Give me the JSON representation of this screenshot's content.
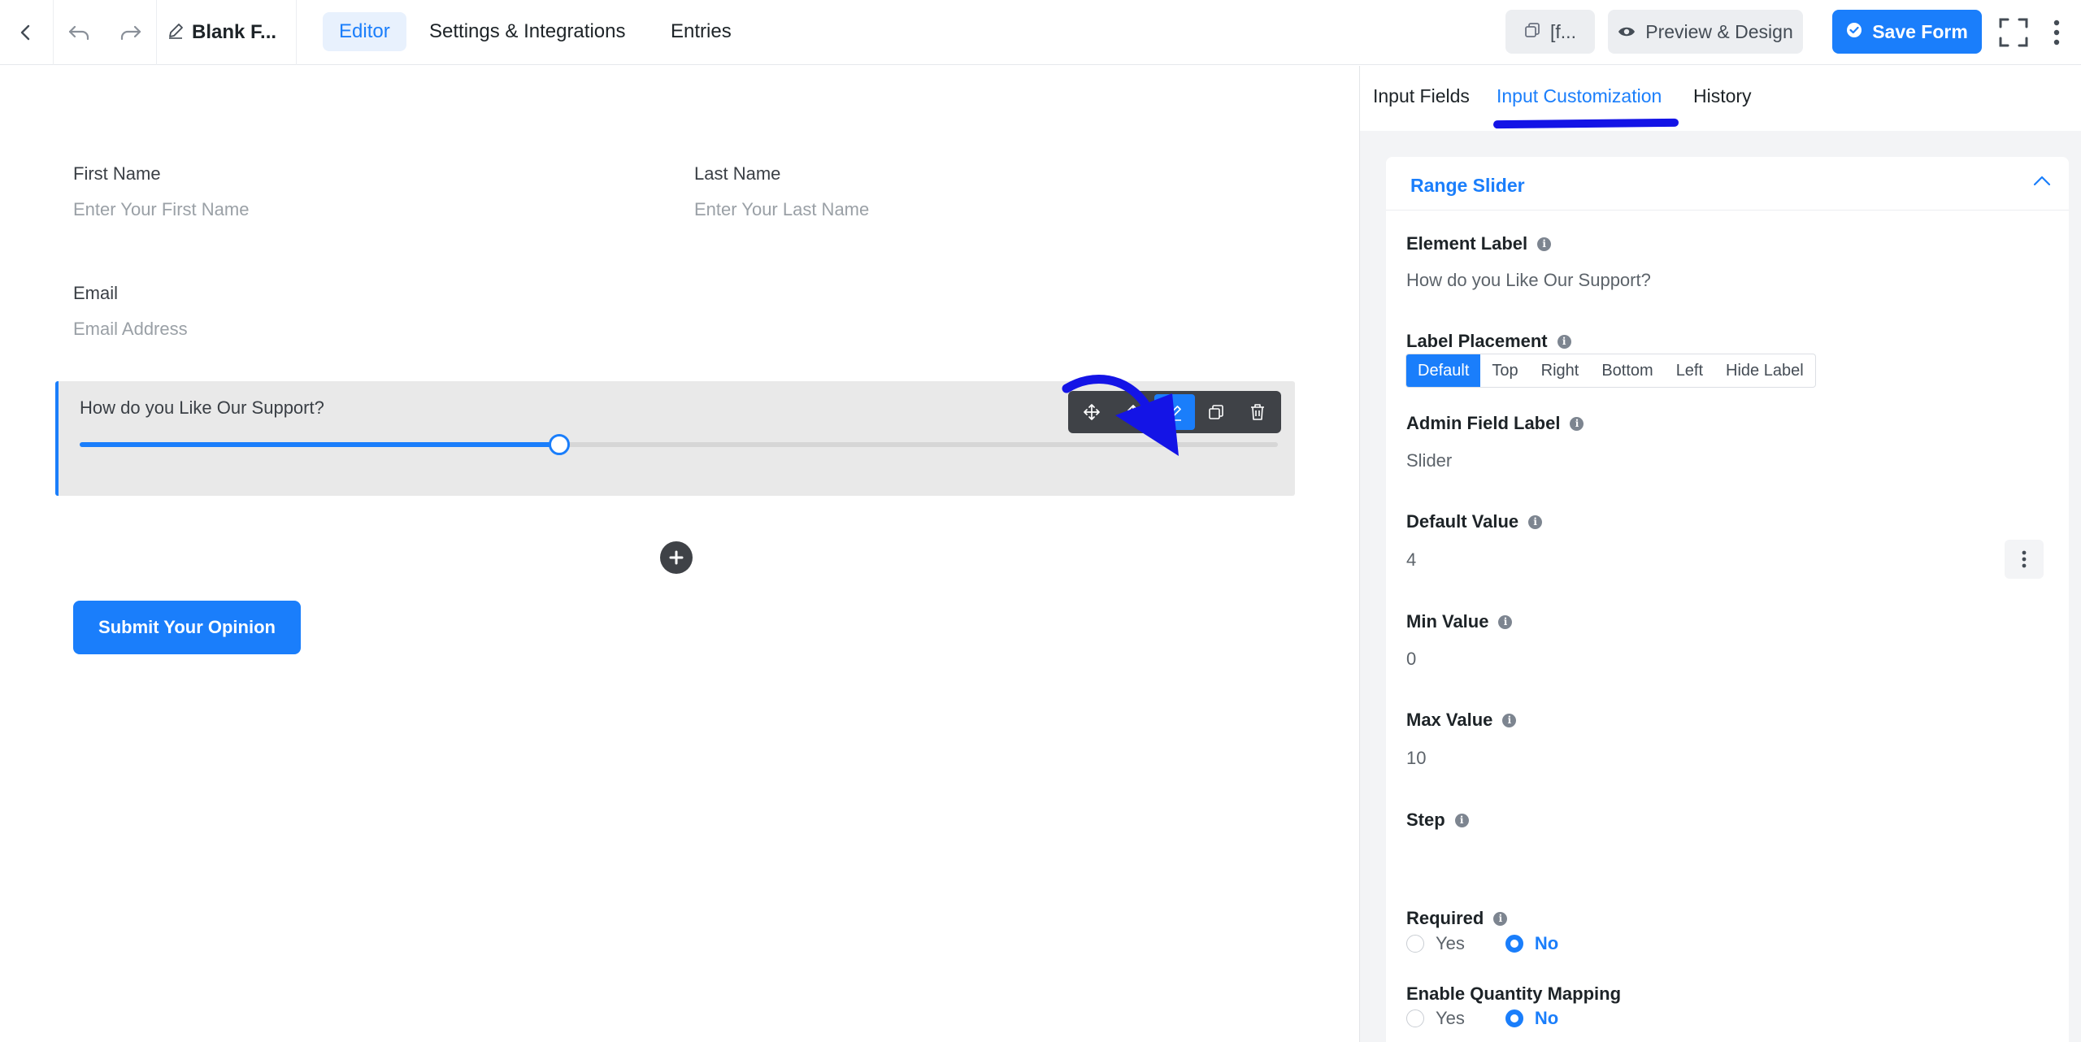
{
  "header": {
    "form_title": "Blank F...",
    "tabs": [
      "Editor",
      "Settings & Integrations",
      "Entries"
    ],
    "shortcode_label": "[f...",
    "preview_label": "Preview & Design",
    "save_label": "Save Form"
  },
  "form": {
    "first_name_label": "First Name",
    "first_name_placeholder": "Enter Your First Name",
    "last_name_label": "Last Name",
    "last_name_placeholder": "Enter Your Last Name",
    "email_label": "Email",
    "email_placeholder": "Email Address",
    "slider_label": "How do you Like Our Support?",
    "slider_fill_fraction": 0.4,
    "submit_label": "Submit Your Opinion"
  },
  "panel": {
    "tabs": [
      "Input Fields",
      "Input Customization",
      "History"
    ],
    "section_title": "Range Slider",
    "element_label_title": "Element Label",
    "element_label_value": "How do you Like Our Support?",
    "label_placement_title": "Label Placement",
    "placements": [
      "Default",
      "Top",
      "Right",
      "Bottom",
      "Left",
      "Hide Label"
    ],
    "admin_label_title": "Admin Field Label",
    "admin_label_value": "Slider",
    "default_value_title": "Default Value",
    "default_value": "4",
    "min_value_title": "Min Value",
    "min_value": "0",
    "max_value_title": "Max Value",
    "max_value": "10",
    "step_title": "Step",
    "required_title": "Required",
    "quantity_title": "Enable Quantity Mapping",
    "yes_label": "Yes",
    "no_label": "No"
  },
  "colors": {
    "accent": "#1a7efb",
    "annotation": "#1414e6"
  }
}
